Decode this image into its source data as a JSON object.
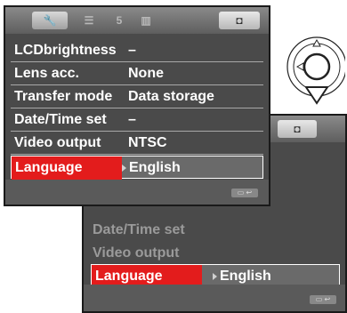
{
  "main_menu": {
    "tabs": [
      "",
      "",
      "5",
      "",
      ""
    ],
    "rows": [
      {
        "label": "LCDbrightness",
        "value": "–"
      },
      {
        "label": "Lens acc.",
        "value": "None"
      },
      {
        "label": "Transfer mode",
        "value": "Data storage"
      },
      {
        "label": "Date/Time set",
        "value": "–"
      },
      {
        "label": "Video output",
        "value": "NTSC"
      },
      {
        "label": "Language",
        "value": "English"
      }
    ]
  },
  "zoom_menu": {
    "rows": [
      {
        "label": "Date/Time set",
        "value": ""
      },
      {
        "label": "Video output",
        "value": ""
      },
      {
        "label": "Language",
        "value": "English"
      }
    ]
  },
  "controller": {
    "up": "up-arrow",
    "left": "left-arrow",
    "down": "down-arrow-highlighted"
  }
}
